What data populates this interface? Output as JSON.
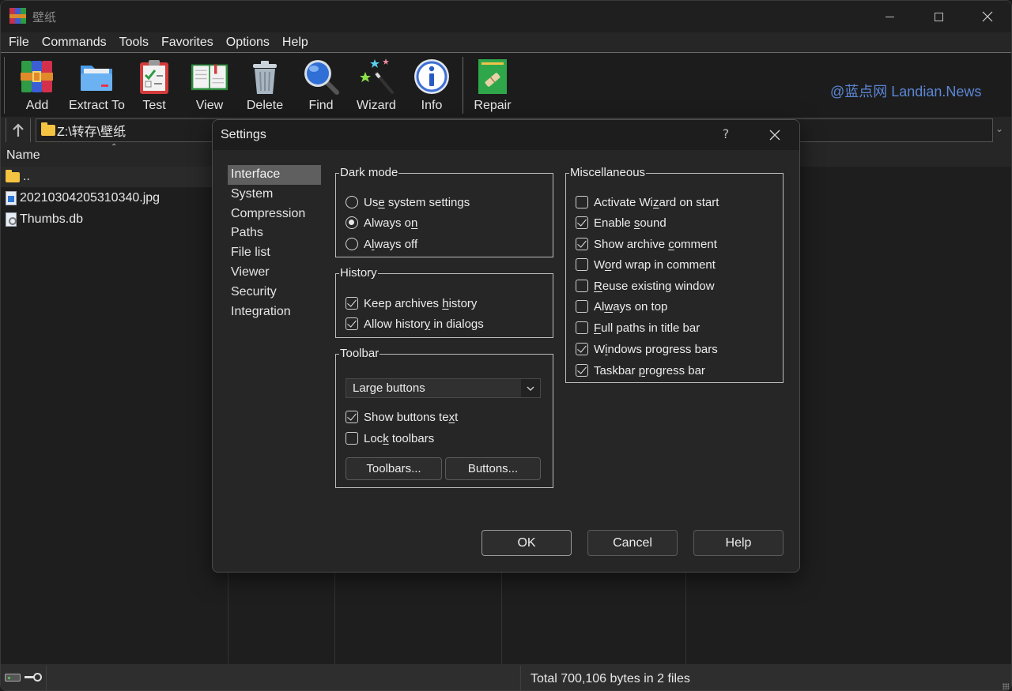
{
  "window": {
    "title": "壁纸",
    "controls": {
      "minimize": "minimize",
      "maximize": "maximize",
      "close": "close"
    }
  },
  "menubar": [
    "File",
    "Commands",
    "Tools",
    "Favorites",
    "Options",
    "Help"
  ],
  "toolbar": {
    "buttons": [
      {
        "label": "Add",
        "icon": "archive-books-icon"
      },
      {
        "label": "Extract To",
        "icon": "folder-extract-icon"
      },
      {
        "label": "Test",
        "icon": "clipboard-check-icon"
      },
      {
        "label": "View",
        "icon": "open-book-icon"
      },
      {
        "label": "Delete",
        "icon": "trash-can-icon"
      },
      {
        "label": "Find",
        "icon": "magnifier-icon"
      },
      {
        "label": "Wizard",
        "icon": "magic-wand-icon"
      },
      {
        "label": "Info",
        "icon": "info-icon"
      },
      {
        "label": "Repair",
        "icon": "repair-kit-icon"
      }
    ]
  },
  "watermark": "@蓝点网 Landian.News",
  "address": {
    "path": "Z:\\转存\\壁纸"
  },
  "filelist": {
    "columns": [
      "Name"
    ],
    "rows": [
      {
        "name": "..",
        "type": "folder"
      },
      {
        "name": "20210304205310340.jpg",
        "type": "image"
      },
      {
        "name": "Thumbs.db",
        "type": "system"
      }
    ]
  },
  "statusbar": {
    "text": "Total 700,106 bytes in 2 files"
  },
  "dialog": {
    "title": "Settings",
    "help_glyph": "?",
    "nav": [
      "Interface",
      "System",
      "Compression",
      "Paths",
      "File list",
      "Viewer",
      "Security",
      "Integration"
    ],
    "nav_selected": "Interface",
    "dark_mode": {
      "legend": "Dark mode",
      "options": [
        {
          "pre": "Us",
          "acc": "e",
          "post": " system settings",
          "checked": false
        },
        {
          "pre": "Always o",
          "acc": "n",
          "post": "",
          "checked": true
        },
        {
          "pre": "A",
          "acc": "l",
          "post": "ways off",
          "checked": false
        }
      ]
    },
    "history": {
      "legend": "History",
      "options": [
        {
          "pre": "Keep archives ",
          "acc": "h",
          "post": "istory",
          "checked": true
        },
        {
          "pre": "Allow histor",
          "acc": "y",
          "post": " in dialogs",
          "checked": true
        }
      ]
    },
    "toolbar": {
      "legend": "Toolbar",
      "select_value": "Large buttons",
      "options": [
        {
          "pre": "Show buttons te",
          "acc": "x",
          "post": "t",
          "checked": true
        },
        {
          "pre": "Loc",
          "acc": "k",
          "post": " toolbars",
          "checked": false
        }
      ],
      "toolbars_button": "Toolbars...",
      "buttons_button": "Buttons..."
    },
    "misc": {
      "legend": "Miscellaneous",
      "options": [
        {
          "pre": "Activate Wi",
          "acc": "z",
          "post": "ard on start",
          "checked": false
        },
        {
          "pre": "Enable ",
          "acc": "s",
          "post": "ound",
          "checked": true
        },
        {
          "pre": "Show archive ",
          "acc": "c",
          "post": "omment",
          "checked": true
        },
        {
          "pre": "W",
          "acc": "o",
          "post": "rd wrap in comment",
          "checked": false
        },
        {
          "pre": "",
          "acc": "R",
          "post": "euse existing window",
          "checked": false
        },
        {
          "pre": "Al",
          "acc": "w",
          "post": "ays on top",
          "checked": false
        },
        {
          "pre": "",
          "acc": "F",
          "post": "ull paths in title bar",
          "checked": false
        },
        {
          "pre": "W",
          "acc": "i",
          "post": "ndows progress bars",
          "checked": true
        },
        {
          "pre": "Taskbar ",
          "acc": "p",
          "post": "rogress bar",
          "checked": true
        }
      ]
    },
    "buttons": {
      "ok": "OK",
      "cancel": "Cancel",
      "help": "Help"
    }
  }
}
